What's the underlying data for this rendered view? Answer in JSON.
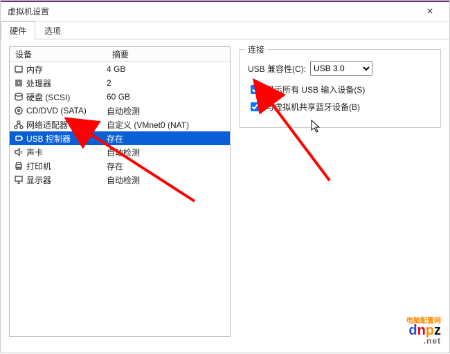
{
  "window": {
    "title": "虚拟机设置"
  },
  "tabs": {
    "hardware": "硬件",
    "options": "选项"
  },
  "list": {
    "head_device": "设备",
    "head_summary": "摘要",
    "rows": [
      {
        "device": "内存",
        "summary": "4 GB"
      },
      {
        "device": "处理器",
        "summary": "2"
      },
      {
        "device": "硬盘 (SCSI)",
        "summary": "60 GB"
      },
      {
        "device": "CD/DVD (SATA)",
        "summary": "自动检测"
      },
      {
        "device": "网络适配器",
        "summary": "自定义 (VMnet0 (NAT)"
      },
      {
        "device": "USB 控制器",
        "summary": "存在"
      },
      {
        "device": "声卡",
        "summary": "自动检测"
      },
      {
        "device": "打印机",
        "summary": "存在"
      },
      {
        "device": "显示器",
        "summary": "自动检测"
      }
    ]
  },
  "right": {
    "group_title": "连接",
    "compat_label": "USB 兼容性(C):",
    "compat_value": "USB 3.0",
    "chk1": "显示所有 USB 输入设备(S)",
    "chk2": "与虚拟机共享蓝牙设备(B)"
  },
  "watermark": {
    "text": "dnpz",
    "suffix": ".net",
    "cn": "电脑配置网"
  }
}
